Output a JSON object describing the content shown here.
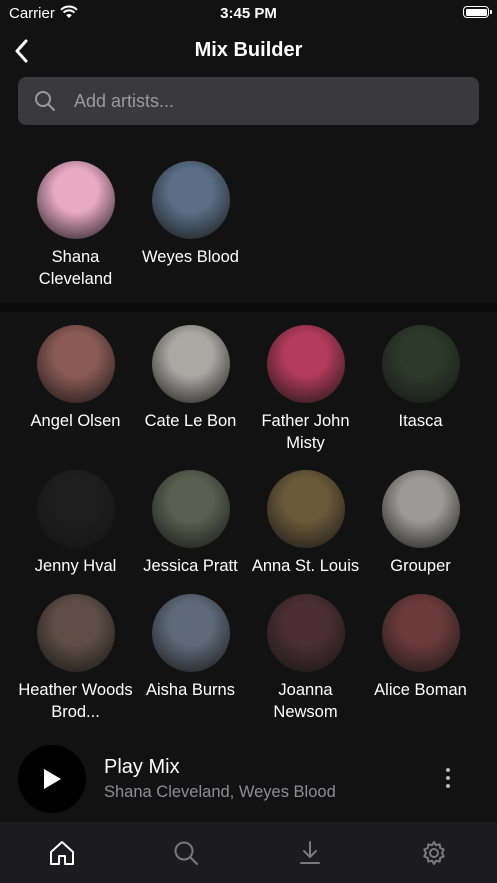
{
  "status_bar": {
    "carrier": "Carrier",
    "time": "3:45 PM"
  },
  "nav": {
    "title": "Mix Builder"
  },
  "search": {
    "placeholder": "Add artists..."
  },
  "selected_artists": [
    {
      "name": "Shana Cleveland",
      "tone": "#e8a9c2"
    },
    {
      "name": "Weyes Blood",
      "tone": "#5a6f86"
    }
  ],
  "suggested_artists": [
    {
      "name": "Angel Olsen",
      "tone": "#8a5a55"
    },
    {
      "name": "Cate Le Bon",
      "tone": "#a9a8a3"
    },
    {
      "name": "Father John Misty",
      "tone": "#b23a5a"
    },
    {
      "name": "Itasca",
      "tone": "#2c3a2a"
    },
    {
      "name": "Jenny Hval",
      "tone": "#1e1e1e"
    },
    {
      "name": "Jessica Pratt",
      "tone": "#5a5f50"
    },
    {
      "name": "Anna St. Louis",
      "tone": "#6b5a3a"
    },
    {
      "name": "Grouper",
      "tone": "#9b9a98"
    },
    {
      "name": "Heather Woods Brod...",
      "tone": "#5e4e45"
    },
    {
      "name": "Aisha Burns",
      "tone": "#5e6a78"
    },
    {
      "name": "Joanna Newsom",
      "tone": "#4a2e34"
    },
    {
      "name": "Alice Boman",
      "tone": "#6b3a3a"
    }
  ],
  "player": {
    "title": "Play Mix",
    "subtitle": "Shana Cleveland, Weyes Blood"
  },
  "tabs": [
    {
      "icon": "home-icon",
      "active": true
    },
    {
      "icon": "search-icon",
      "active": false
    },
    {
      "icon": "download-icon",
      "active": false
    },
    {
      "icon": "settings-icon",
      "active": false
    }
  ]
}
